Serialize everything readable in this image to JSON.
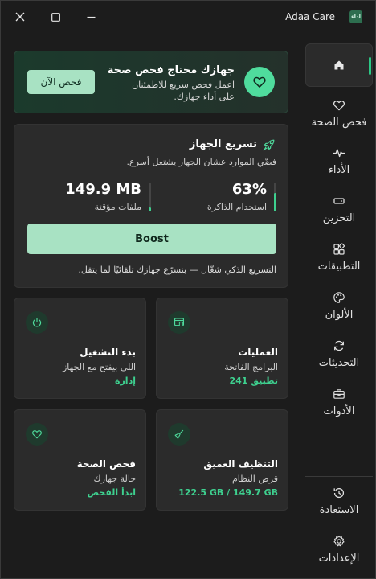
{
  "window": {
    "title": "Adaa Care",
    "logo_text": "اداء",
    "close_icon": "close-icon",
    "maximize_icon": "maximize-icon",
    "minimize_icon": "minimize-icon"
  },
  "nav": {
    "accent": "#2cc785",
    "items": [
      {
        "label": "",
        "icon": "home-icon",
        "active": true
      },
      {
        "label": "فحص الصحة",
        "icon": "heart-icon"
      },
      {
        "label": "الأداء",
        "icon": "pulse-icon"
      },
      {
        "label": "التخزين",
        "icon": "drive-icon"
      },
      {
        "label": "التطبيقات",
        "icon": "apps-icon"
      },
      {
        "label": "الألوان",
        "icon": "palette-icon"
      },
      {
        "label": "التحديثات",
        "icon": "refresh-icon"
      },
      {
        "label": "الأدوات",
        "icon": "toolbox-icon"
      }
    ],
    "footer": [
      {
        "label": "الاستعادة",
        "icon": "history-icon"
      },
      {
        "label": "الإعدادات",
        "icon": "gear-icon"
      }
    ]
  },
  "banner": {
    "title": "جهازك محتاج فحص صحة",
    "text": "اعمل فحص سريع للاطمئنان على أداء جهازك.",
    "button": "فحص الآن",
    "icon": "heart-icon"
  },
  "boost": {
    "title": "تسريع الجهاز",
    "icon": "rocket-icon",
    "description": "فضّي الموارد عشان الجهاز يشتغل أسرع.",
    "memory": {
      "value": "63%",
      "caption": "استخدام الذاكرة",
      "level": 0.63
    },
    "temp": {
      "value": "149.9 MB",
      "caption": "ملفات مؤقتة",
      "level": 0.15
    },
    "button": "Boost",
    "note": "التسريع الذكي شغّال — بنسرّع جهازك تلقائيًا لما يتقل."
  },
  "tiles": {
    "processes": {
      "title": "العمليات",
      "subtitle": "البرامج الفاتحة",
      "link": "241 تطبيق",
      "icon": "processes-icon"
    },
    "startup": {
      "title": "بدء التشغيل",
      "subtitle": "اللي بيفتح مع الجهاز",
      "link": "إدارة",
      "icon": "power-icon"
    },
    "cleanup": {
      "title": "التنظيف العميق",
      "subtitle": "قرص النظام",
      "link": "122.5 GB / 149.7 GB",
      "icon": "broom-icon"
    },
    "health": {
      "title": "فحص الصحة",
      "subtitle": "حالة جهازك",
      "link": "ابدأ الفحص",
      "icon": "heart-icon"
    }
  }
}
